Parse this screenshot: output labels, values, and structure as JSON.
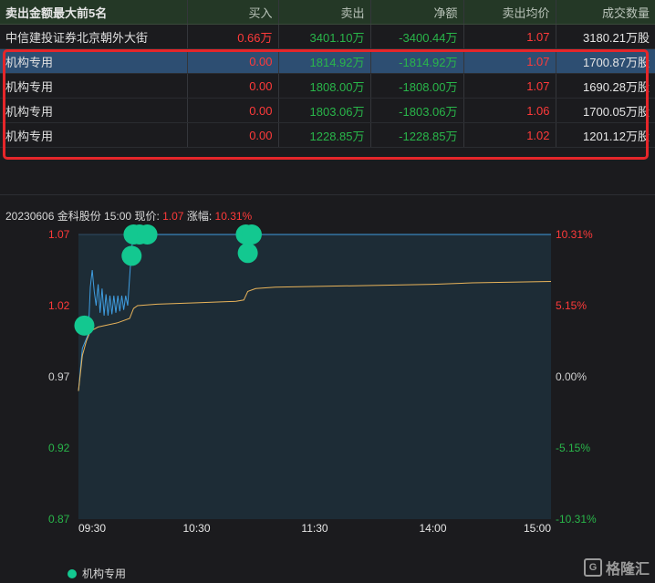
{
  "table": {
    "headers": [
      "卖出金额最大前5名",
      "买入",
      "卖出",
      "净额",
      "卖出均价",
      "成交数量"
    ],
    "rows": [
      [
        "中信建投证券北京朝外大街",
        "0.66万",
        "3401.10万",
        "-3400.44万",
        "1.07",
        "3180.21万股"
      ],
      [
        "机构专用",
        "0.00",
        "1814.92万",
        "-1814.92万",
        "1.07",
        "1700.87万股"
      ],
      [
        "机构专用",
        "0.00",
        "1808.00万",
        "-1808.00万",
        "1.07",
        "1690.28万股"
      ],
      [
        "机构专用",
        "0.00",
        "1803.06万",
        "-1803.06万",
        "1.06",
        "1700.05万股"
      ],
      [
        "机构专用",
        "0.00",
        "1228.85万",
        "-1228.85万",
        "1.02",
        "1201.12万股"
      ]
    ]
  },
  "chart_header": {
    "date_name_time": "20230606 金科股份 15:00",
    "price_label": "现价:",
    "price": "1.07",
    "change_label": "涨幅:",
    "change": "10.31%"
  },
  "legend": {
    "label": "机构专用"
  },
  "watermark": "格隆汇",
  "colors": {
    "price_line": "#3f9de0",
    "avg_line": "#e8b35a",
    "marker": "#13c890",
    "red": "#ff3a3a",
    "green": "#29b64a",
    "plot_bg": "#1d2c36"
  },
  "chart_data": {
    "type": "line",
    "ylim": [
      0.87,
      1.07
    ],
    "y_ticks_left": [
      "1.07",
      "1.02",
      "0.97",
      "0.92",
      "0.87"
    ],
    "y_ticks_right": [
      "10.31%",
      "5.15%",
      "0.00%",
      "-5.15%",
      "-10.31%"
    ],
    "x_ticks": [
      "09:30",
      "10:30",
      "11:30",
      "14:00",
      "15:00"
    ],
    "x_range_minutes": [
      0,
      240
    ],
    "series": [
      {
        "key": "price",
        "points": [
          [
            0,
            0.96
          ],
          [
            2,
            0.99
          ],
          [
            5,
            1.0
          ],
          [
            6,
            1.033
          ],
          [
            7,
            1.045
          ],
          [
            8,
            1.03
          ],
          [
            9,
            1.02
          ],
          [
            10,
            1.035
          ],
          [
            11,
            1.015
          ],
          [
            12,
            1.032
          ],
          [
            13,
            1.013
          ],
          [
            14,
            1.028
          ],
          [
            15,
            1.013
          ],
          [
            16,
            1.027
          ],
          [
            17,
            1.014
          ],
          [
            18,
            1.027
          ],
          [
            19,
            1.015
          ],
          [
            20,
            1.027
          ],
          [
            21,
            1.016
          ],
          [
            22,
            1.027
          ],
          [
            23,
            1.017
          ],
          [
            24,
            1.027
          ],
          [
            25,
            1.02
          ],
          [
            26,
            1.04
          ],
          [
            27,
            1.06
          ],
          [
            28,
            1.07
          ],
          [
            40,
            1.07
          ],
          [
            80,
            1.07
          ],
          [
            84,
            1.065
          ],
          [
            86,
            1.07
          ],
          [
            88,
            1.063
          ],
          [
            90,
            1.07
          ],
          [
            240,
            1.07
          ]
        ]
      },
      {
        "key": "avg",
        "points": [
          [
            0,
            0.96
          ],
          [
            2,
            0.985
          ],
          [
            4,
            0.995
          ],
          [
            6,
            1.002
          ],
          [
            10,
            1.005
          ],
          [
            20,
            1.008
          ],
          [
            26,
            1.011
          ],
          [
            28,
            1.018
          ],
          [
            30,
            1.02
          ],
          [
            40,
            1.021
          ],
          [
            60,
            1.022
          ],
          [
            80,
            1.023
          ],
          [
            84,
            1.024
          ],
          [
            86,
            1.03
          ],
          [
            90,
            1.032
          ],
          [
            100,
            1.033
          ],
          [
            140,
            1.034
          ],
          [
            180,
            1.035
          ],
          [
            200,
            1.036
          ],
          [
            240,
            1.037
          ]
        ]
      }
    ],
    "markers": {
      "label": "机构专用",
      "points": [
        [
          3,
          1.006
        ],
        [
          27,
          1.055
        ],
        [
          28,
          1.07
        ],
        [
          31,
          1.07
        ],
        [
          35,
          1.07
        ],
        [
          85,
          1.07
        ],
        [
          86,
          1.057
        ],
        [
          88,
          1.07
        ]
      ]
    }
  }
}
